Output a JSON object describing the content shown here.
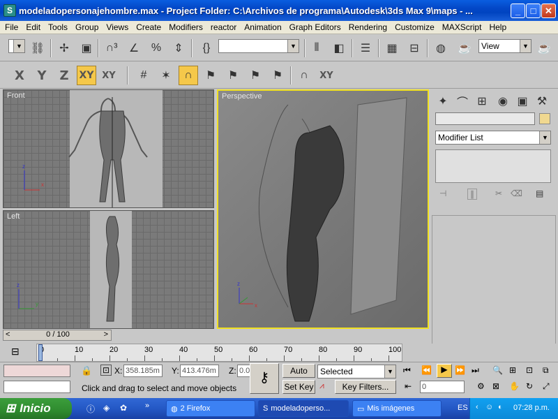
{
  "window": {
    "title": "modeladopersonajehombre.max     - Project Folder: C:\\Archivos de programa\\Autodesk\\3ds Max 9\\maps     - ...",
    "minimize": "_",
    "maximize": "□",
    "close": "✕"
  },
  "menu": [
    "File",
    "Edit",
    "Tools",
    "Group",
    "Views",
    "Create",
    "Modifiers",
    "reactor",
    "Animation",
    "Graph Editors",
    "Rendering",
    "Customize",
    "MAXScript",
    "Help"
  ],
  "toolbar": {
    "view_combo": "View",
    "axis_x": "X",
    "axis_y": "Y",
    "axis_z": "Z",
    "axis_xy": "XY",
    "axis_xy2": "XY",
    "axis_xy3": "XY"
  },
  "viewports": {
    "front": "Front",
    "left": "Left",
    "perspective": "Perspective"
  },
  "command_panel": {
    "modifier_list": "Modifier List"
  },
  "timeline": {
    "frame_slider": "0 / 100",
    "ticks": [
      "0",
      "10",
      "20",
      "30",
      "40",
      "50",
      "60",
      "70",
      "80",
      "90",
      "100"
    ]
  },
  "status": {
    "x_label": "X:",
    "x_value": "358.185m",
    "y_label": "Y:",
    "y_value": "413.476m",
    "z_label": "Z:",
    "z_value": "0.0",
    "auto_key": "Auto Key",
    "set_key": "Set Key",
    "selected": "Selected",
    "key_filters": "Key Filters...",
    "frame_field": "0",
    "prompt": "Click and drag to select and move objects"
  },
  "taskbar": {
    "start": "Inicio",
    "tasks": [
      {
        "label": "2 Firefox"
      },
      {
        "label": "modeladoperso..."
      },
      {
        "label": "Mis imágenes"
      }
    ],
    "lang": "ES",
    "clock": "07:28 p.m."
  }
}
